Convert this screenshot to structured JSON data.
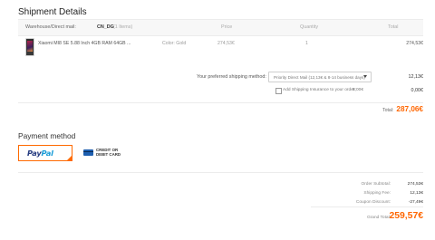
{
  "shipment": {
    "title": "Shipment Details",
    "warehouse_label": "Warehouse/Direct mail:",
    "warehouse_code": "CN_DG",
    "items_count": "(1 Items)",
    "col_price": "Price",
    "col_quantity": "Quantity",
    "col_total": "Total",
    "product": {
      "name": "Xiaomi MI8 SE 5.88 Inch 4GB RAM 64GB ...",
      "color": "Color: Gold",
      "price": "274,53€",
      "quantity": "1",
      "total": "274,53€"
    },
    "shipping_label": "Your preferred shipping method:",
    "shipping_option": "Priority Direct Mail (12,13€ & 8-14 business days)",
    "shipping_cost": "12,13€",
    "insurance_label": "Add Shipping Insurance to your order:",
    "insurance_amount": "5,00€",
    "insurance_cost": "0,00€",
    "total_label": "Total:",
    "total_value": "287,06€"
  },
  "payment": {
    "title": "Payment method",
    "paypal_pay": "Pay",
    "paypal_pal": "Pal",
    "card_line1": "CREDIT OR",
    "card_line2": "DEBIT CARD"
  },
  "summary": {
    "subtotal_label": "Order Subtotal:",
    "subtotal_value": "274,53€",
    "shipping_label": "Shipping Fee:",
    "shipping_value": "12,13€",
    "coupon_label": "Coupon Discount:",
    "coupon_value": "-27,49€",
    "grand_label": "Grand Total:",
    "grand_value": "259,57€"
  },
  "colors": {
    "accent": "#ff6600",
    "paypal_dark": "#253b80",
    "paypal_light": "#179bd7"
  }
}
